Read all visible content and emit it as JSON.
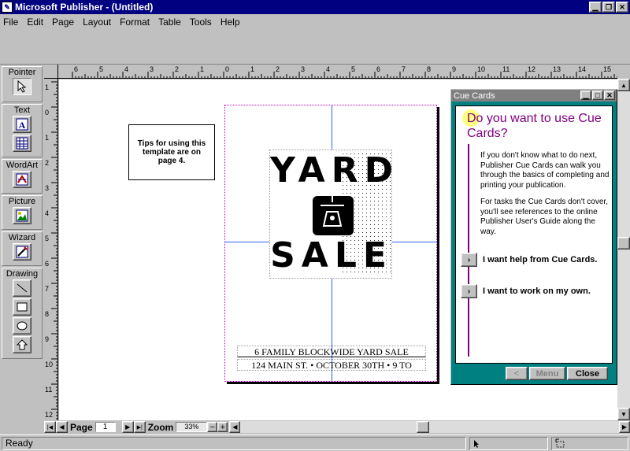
{
  "window": {
    "title": "Microsoft Publisher - (Untitled)"
  },
  "menu": [
    "File",
    "Edit",
    "Page",
    "Layout",
    "Format",
    "Table",
    "Tools",
    "Help"
  ],
  "toolbox": {
    "pointer_label": "Pointer",
    "text_label": "Text",
    "wordart_label": "WordArt",
    "picture_label": "Picture",
    "wizard_label": "Wizard",
    "drawing_label": "Drawing"
  },
  "ruler": {
    "h_ticks": [
      "6",
      "5",
      "4",
      "3",
      "2",
      "1",
      "0",
      "1",
      "2",
      "3",
      "4",
      "5",
      "6",
      "7",
      "8",
      "9",
      "10",
      "11",
      "12",
      "13",
      "14",
      "15"
    ],
    "v_ticks": [
      "1",
      "0",
      "1",
      "2",
      "3",
      "4",
      "5",
      "6",
      "7",
      "8",
      "9",
      "10",
      "11",
      "12"
    ]
  },
  "tip": {
    "text": "Tips for using this template are on page 4."
  },
  "flyer": {
    "headline_top": "YARD",
    "headline_bottom": "SALE",
    "line1": "6 FAMILY BLOCKWIDE YARD SALE",
    "line2": "124 MAIN ST. • OCTOBER 30TH • 9 TO"
  },
  "cuecards": {
    "title": "Cue Cards",
    "heading": "Do you want to use Cue Cards?",
    "para1": "If you don't know what to do next, Publisher Cue Cards can walk you through the basics of completing and printing your publication.",
    "para2": "For tasks the Cue Cards don't cover, you'll see references to the online Publisher User's Guide along the way.",
    "option1": "I want help from Cue Cards.",
    "option2": "I want to work on my own.",
    "back_label": "<",
    "menu_label": "Menu",
    "close_label": "Close"
  },
  "nav": {
    "page_label": "Page",
    "page_value": "1",
    "zoom_label": "Zoom",
    "zoom_value": "33%"
  },
  "status": {
    "text": "Ready"
  }
}
